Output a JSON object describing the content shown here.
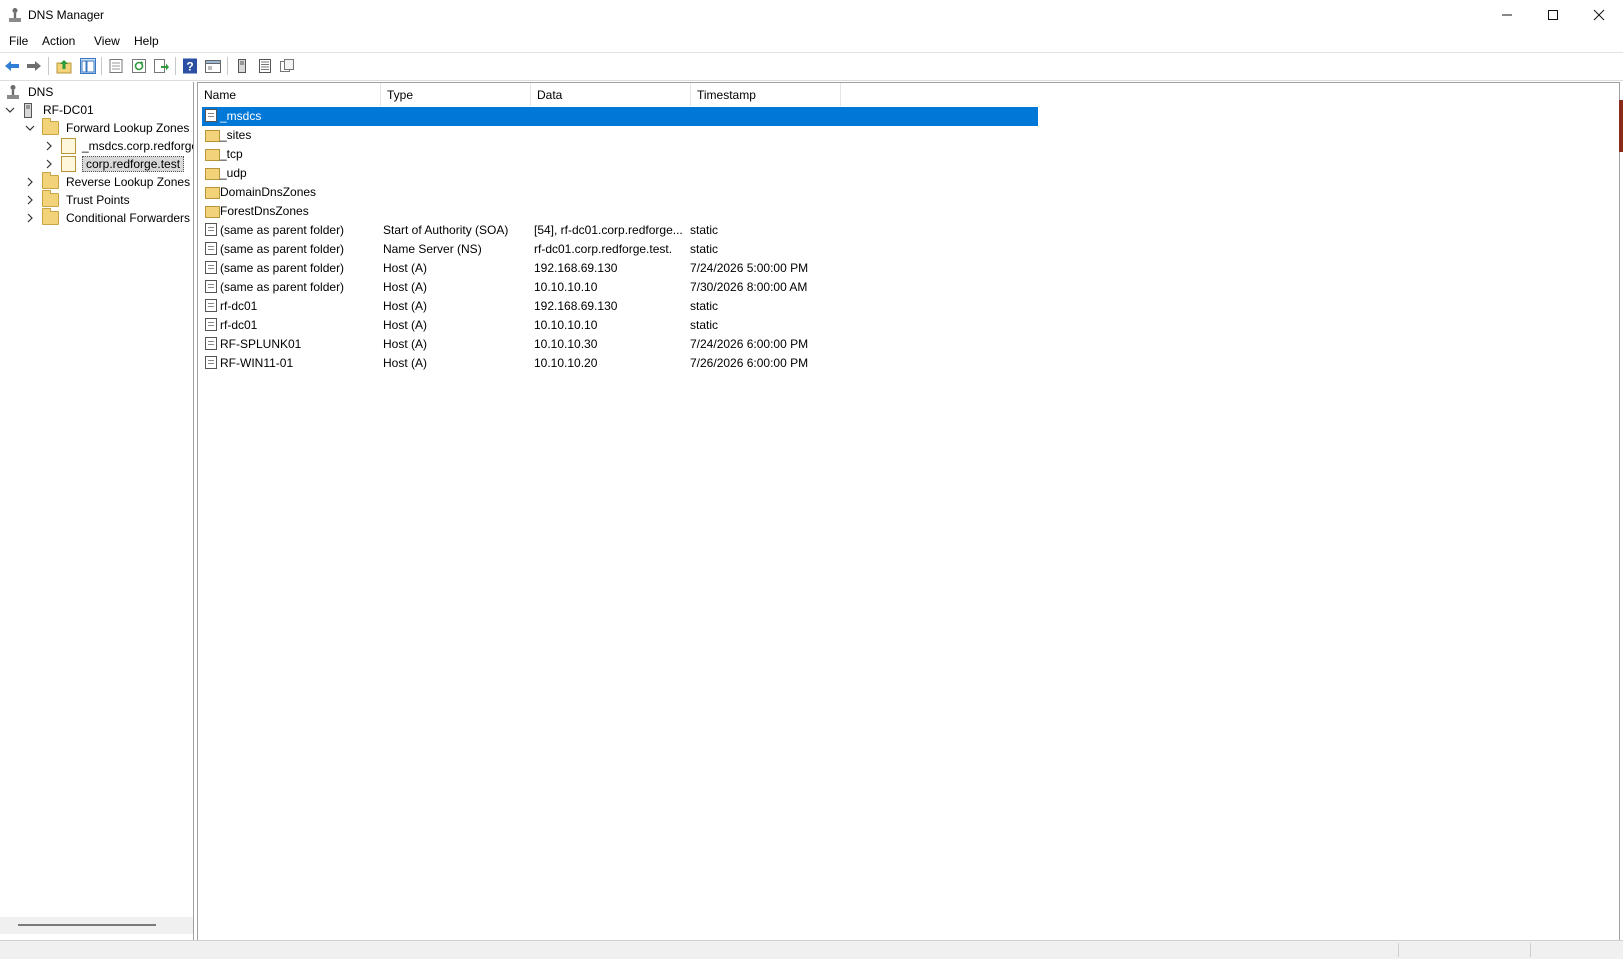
{
  "window": {
    "title": "DNS Manager"
  },
  "menu": [
    "File",
    "Action",
    "View",
    "Help"
  ],
  "toolbar": [
    "back-icon",
    "forward-icon",
    "up-folder-icon",
    "show-hide-console-tree-icon",
    "properties-icon",
    "refresh-icon",
    "export-list-icon",
    "help-icon",
    "mmc-view-icon",
    "server-icon",
    "list-icon",
    "filter-icon"
  ],
  "tree": {
    "root": "DNS",
    "server": "RF-DC01",
    "forward_zones": "Forward Lookup Zones",
    "zone_msdcs": "_msdcs.corp.redforge.test",
    "zone_corp": "corp.redforge.test",
    "reverse_zones": "Reverse Lookup Zones",
    "trust_points": "Trust Points",
    "conditional_forwarders": "Conditional Forwarders"
  },
  "list": {
    "columns": {
      "name": "Name",
      "type": "Type",
      "data": "Data",
      "timestamp": "Timestamp"
    },
    "rows": [
      {
        "name": "_msdcs",
        "type": "",
        "data": "",
        "timestamp": "",
        "icon": "delegation-icon"
      },
      {
        "name": "_sites",
        "type": "",
        "data": "",
        "timestamp": "",
        "icon": "folder-icon"
      },
      {
        "name": "_tcp",
        "type": "",
        "data": "",
        "timestamp": "",
        "icon": "folder-icon"
      },
      {
        "name": "_udp",
        "type": "",
        "data": "",
        "timestamp": "",
        "icon": "folder-icon"
      },
      {
        "name": "DomainDnsZones",
        "type": "",
        "data": "",
        "timestamp": "",
        "icon": "folder-icon"
      },
      {
        "name": "ForestDnsZones",
        "type": "",
        "data": "",
        "timestamp": "",
        "icon": "folder-icon"
      },
      {
        "name": "(same as parent folder)",
        "type": "Start of Authority (SOA)",
        "data": "[54], rf-dc01.corp.redforge...",
        "timestamp": "static",
        "icon": "record-icon"
      },
      {
        "name": "(same as parent folder)",
        "type": "Name Server (NS)",
        "data": "rf-dc01.corp.redforge.test.",
        "timestamp": "static",
        "icon": "record-icon"
      },
      {
        "name": "(same as parent folder)",
        "type": "Host (A)",
        "data": "192.168.69.130",
        "timestamp": "7/24/2026 5:00:00 PM",
        "icon": "record-icon"
      },
      {
        "name": "(same as parent folder)",
        "type": "Host (A)",
        "data": "10.10.10.10",
        "timestamp": "7/30/2026 8:00:00 AM",
        "icon": "record-icon"
      },
      {
        "name": "rf-dc01",
        "type": "Host (A)",
        "data": "192.168.69.130",
        "timestamp": "static",
        "icon": "record-icon"
      },
      {
        "name": "rf-dc01",
        "type": "Host (A)",
        "data": "10.10.10.10",
        "timestamp": "static",
        "icon": "record-icon"
      },
      {
        "name": "RF-SPLUNK01",
        "type": "Host (A)",
        "data": "10.10.10.30",
        "timestamp": "7/24/2026 6:00:00 PM",
        "icon": "record-icon"
      },
      {
        "name": "RF-WIN11-01",
        "type": "Host (A)",
        "data": "10.10.10.20",
        "timestamp": "7/26/2026 6:00:00 PM",
        "icon": "record-icon"
      }
    ]
  },
  "colors": {
    "selection": "#0078d7",
    "folder": "#f2d37a"
  }
}
